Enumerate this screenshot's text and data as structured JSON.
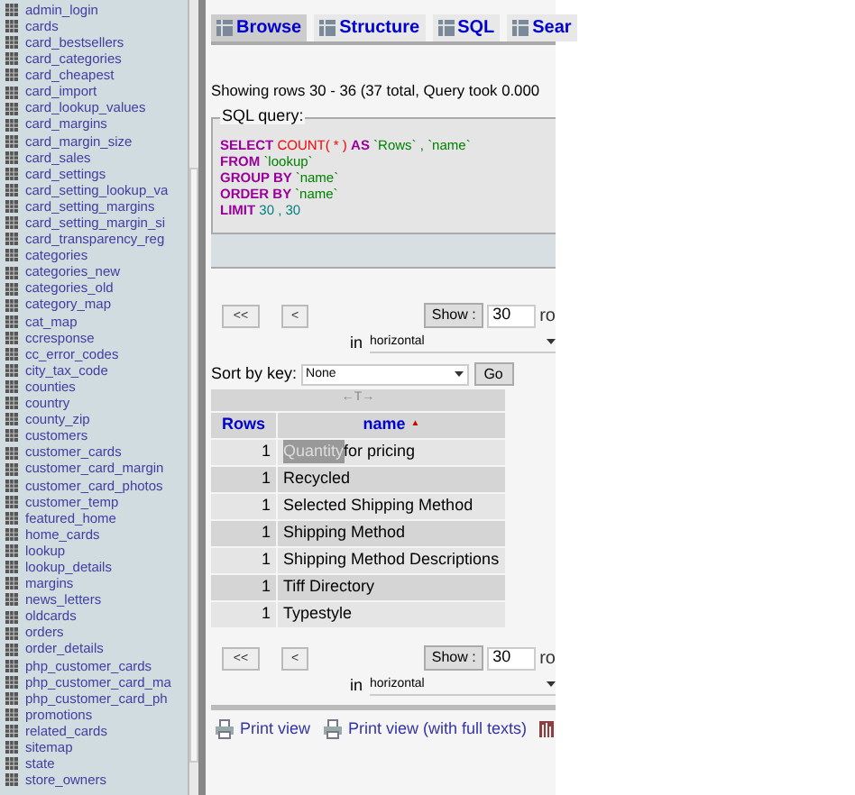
{
  "sidebar": {
    "tables": [
      "admin_login",
      "cards",
      "card_bestsellers",
      "card_categories",
      "card_cheapest",
      "card_import",
      "card_lookup_values",
      "card_margins",
      "card_margin_size",
      "card_sales",
      "card_settings",
      "card_setting_lookup_va",
      "card_setting_margins",
      "card_setting_margin_si",
      "card_transparency_reg",
      "categories",
      "categories_new",
      "categories_old",
      "category_map",
      "cat_map",
      "ccresponse",
      "cc_error_codes",
      "city_tax_code",
      "counties",
      "country",
      "county_zip",
      "customers",
      "customer_cards",
      "customer_card_margin",
      "customer_card_photos",
      "customer_temp",
      "featured_home",
      "home_cards",
      "lookup",
      "lookup_details",
      "margins",
      "news_letters",
      "oldcards",
      "orders",
      "order_details",
      "php_customer_cards",
      "php_customer_card_ma",
      "php_customer_card_ph",
      "promotions",
      "related_cards",
      "sitemap",
      "state",
      "store_owners"
    ]
  },
  "tabs": [
    {
      "label": "Browse",
      "selected": true
    },
    {
      "label": "Structure",
      "selected": false
    },
    {
      "label": "SQL",
      "selected": false
    },
    {
      "label": "Sear",
      "selected": false
    }
  ],
  "status": "Showing rows 30 - 36 (37 total, Query took 0.000",
  "sql_query": {
    "legend": "SQL query:",
    "lines": [
      [
        {
          "kind": "keyword",
          "text": "SELECT"
        },
        {
          "kind": "function",
          "text": "COUNT( * )"
        },
        {
          "kind": "keyword",
          "text": "AS"
        },
        {
          "kind": "string",
          "text": "`Rows` ,"
        },
        {
          "kind": "string",
          "text": "`name`"
        }
      ],
      [
        {
          "kind": "keyword",
          "text": "FROM"
        },
        {
          "kind": "string",
          "text": "`lookup`"
        }
      ],
      [
        {
          "kind": "keyword",
          "text": "GROUP BY"
        },
        {
          "kind": "string",
          "text": "`name`"
        }
      ],
      [
        {
          "kind": "keyword",
          "text": "ORDER BY"
        },
        {
          "kind": "string",
          "text": "`name`"
        }
      ],
      [
        {
          "kind": "keyword",
          "text": "LIMIT"
        },
        {
          "kind": "number",
          "text": "30 , 30"
        }
      ]
    ]
  },
  "navigation_top": {
    "first": "<<",
    "prev": "<",
    "show": "Show :",
    "count": "30",
    "rows_label": "ro",
    "in": "in",
    "mode": "horizontal"
  },
  "sort": {
    "label": "Sort by key:",
    "value": "None",
    "go": "Go"
  },
  "table": {
    "arrows": "←T→",
    "columns": [
      "Rows",
      "name"
    ],
    "sort_mark": "▲",
    "rows": [
      {
        "count": "1",
        "name": [
          {
            "text": "Quantity",
            "selected": true
          },
          {
            "text": " for pricing",
            "selected": false
          }
        ]
      },
      {
        "count": "1",
        "name": [
          {
            "text": "Recycled",
            "selected": false
          }
        ]
      },
      {
        "count": "1",
        "name": [
          {
            "text": "Selected Shipping Method",
            "selected": false
          }
        ]
      },
      {
        "count": "1",
        "name": [
          {
            "text": "Shipping Method",
            "selected": false
          }
        ]
      },
      {
        "count": "1",
        "name": [
          {
            "text": "Shipping Method Descriptions",
            "selected": false
          }
        ]
      },
      {
        "count": "1",
        "name": [
          {
            "text": "Tiff Directory",
            "selected": false
          }
        ]
      },
      {
        "count": "1",
        "name": [
          {
            "text": "Typestyle",
            "selected": false
          }
        ]
      }
    ]
  },
  "navigation_bottom": {
    "first": "<<",
    "prev": "<",
    "show": "Show :",
    "count": "30",
    "rows_label": "ro",
    "in": "in",
    "mode": "horizontal"
  },
  "links": [
    "Print view",
    "Print view (with full texts)"
  ]
}
